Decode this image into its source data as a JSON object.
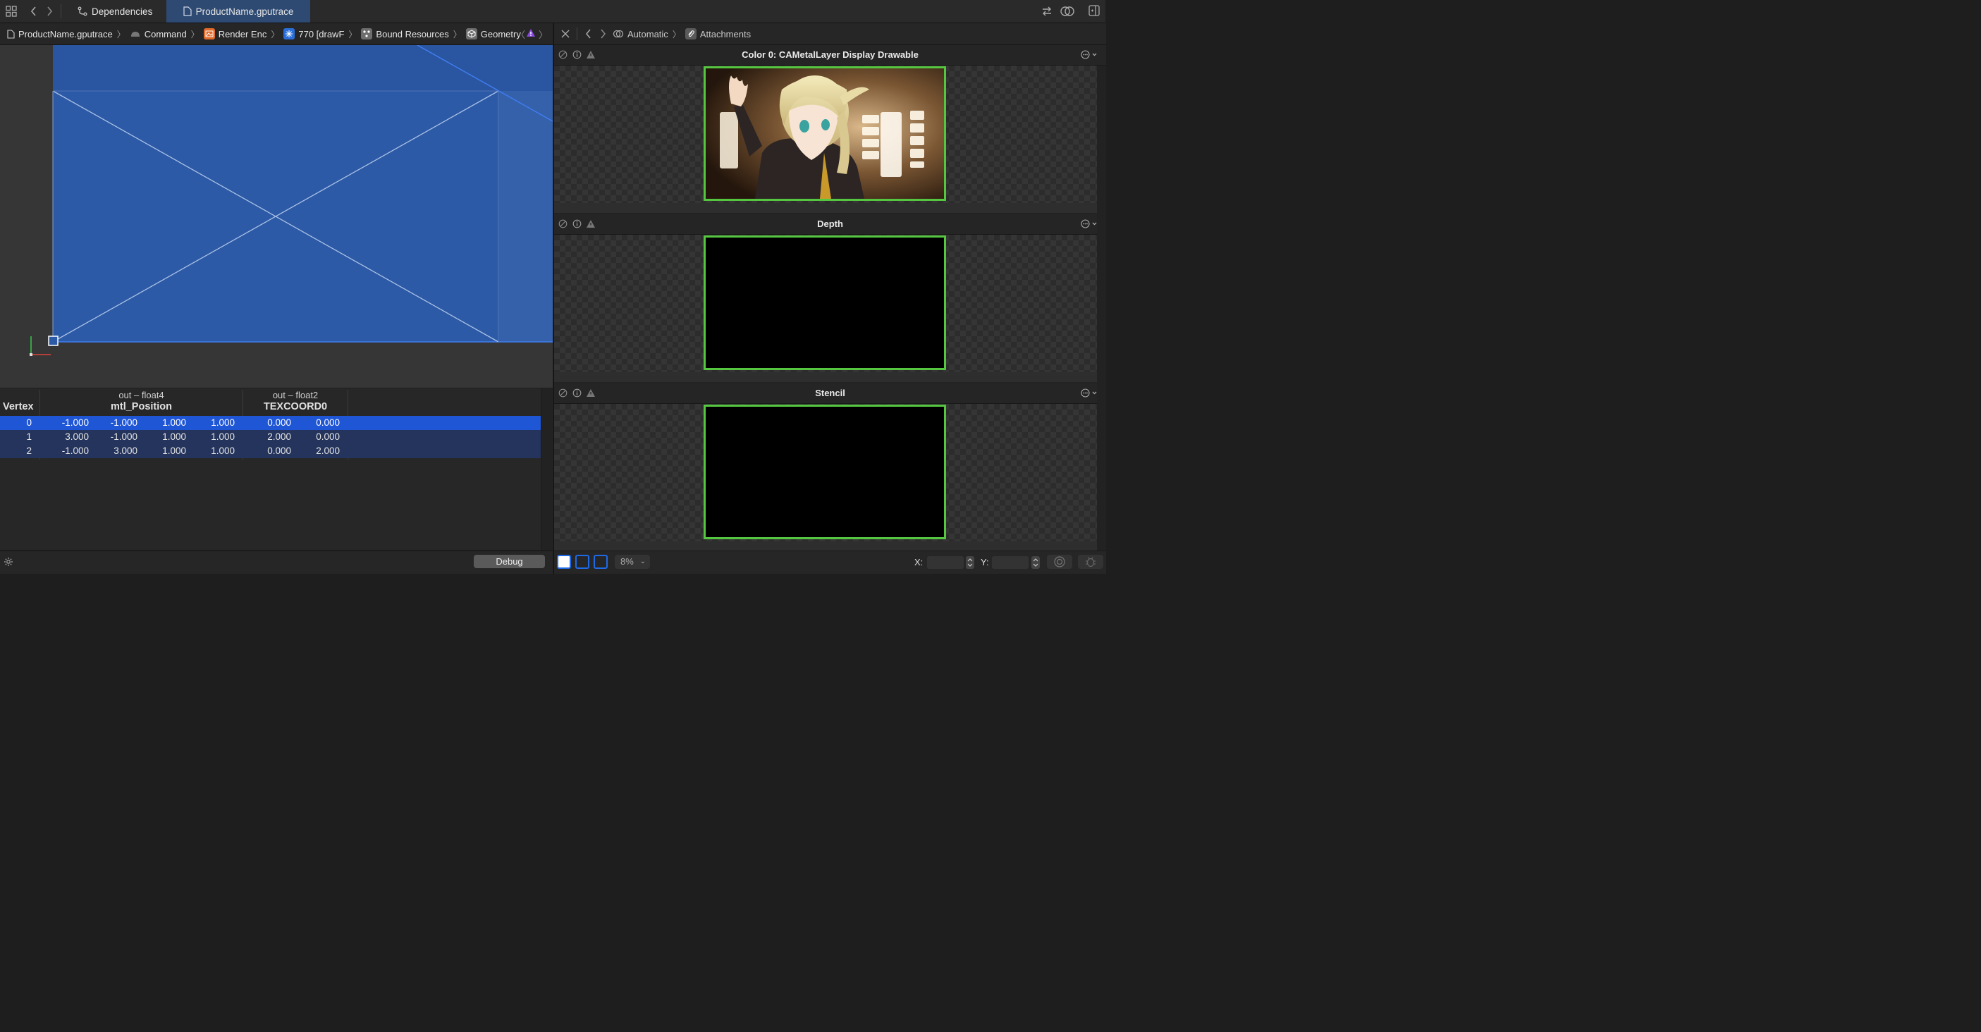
{
  "tabs": {
    "dependencies": "Dependencies",
    "active_file": "ProductName.gputrace"
  },
  "breadcrumb": {
    "file": "ProductName.gputrace",
    "command": "Command",
    "render_encoder": "Render Enc",
    "draw": "770 [drawF",
    "bound_resources": "Bound Resources",
    "geometry": "Geometry"
  },
  "right_nav": {
    "mode": "Automatic",
    "section": "Attachments"
  },
  "attachments": [
    {
      "title": "Color 0: CAMetalLayer Display Drawable"
    },
    {
      "title": "Depth"
    },
    {
      "title": "Stencil"
    }
  ],
  "vertex_table": {
    "vertex_header": "Vertex",
    "groups": [
      {
        "type": "out – float4",
        "name": "mtl_Position"
      },
      {
        "type": "out – float2",
        "name": "TEXCOORD0"
      }
    ],
    "rows": [
      {
        "id": "0",
        "pos": [
          "-1.000",
          "-1.000",
          "1.000",
          "1.000"
        ],
        "tex": [
          "0.000",
          "0.000"
        ],
        "selected": true
      },
      {
        "id": "1",
        "pos": [
          "3.000",
          "-1.000",
          "1.000",
          "1.000"
        ],
        "tex": [
          "2.000",
          "0.000"
        ],
        "selected": false
      },
      {
        "id": "2",
        "pos": [
          "-1.000",
          "3.000",
          "1.000",
          "1.000"
        ],
        "tex": [
          "0.000",
          "2.000"
        ],
        "selected": false
      }
    ]
  },
  "footer": {
    "debug_label": "Debug",
    "zoom": "8%",
    "x_label": "X:",
    "y_label": "Y:"
  },
  "colors": {
    "accent_blue": "#1f56d6",
    "frame_green": "#55c640",
    "geometry_fill": "#2d5aa6"
  }
}
